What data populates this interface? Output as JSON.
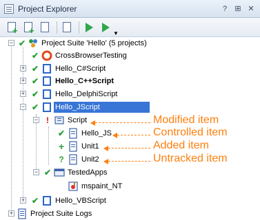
{
  "window": {
    "title": "Project Explorer",
    "buttons": {
      "help": "?",
      "pin": "⊞",
      "close": "✕"
    }
  },
  "toolbar": {
    "icons": [
      "add-project-icon",
      "add-item-icon",
      "add-existing-icon",
      "doc-settings-icon",
      "run-icon",
      "run-dropdown-icon"
    ]
  },
  "tree": {
    "suite_label": "Project Suite 'Hello' (5 projects)",
    "crossbrowser": "CrossBrowserTesting",
    "hello_cs": "Hello_C#Script",
    "hello_cpp": "Hello_C++Script",
    "hello_delphi": "Hello_DelphiScript",
    "hello_js": "Hello_JScript",
    "script": "Script",
    "hello_js_unit": "Hello_JS",
    "unit1": "Unit1",
    "unit2": "Unit2",
    "tested_apps": "TestedApps",
    "mspaint": "mspaint_NT",
    "hello_vb": "Hello_VBScript",
    "suite_logs": "Project Suite Logs"
  },
  "status_symbols": {
    "check": "✔",
    "modified": "!",
    "added": "+",
    "untracked": "?"
  },
  "callouts": {
    "modified": "Modified item",
    "controlled": "Controlled item",
    "added": "Added item",
    "untracked": "Untracked item"
  },
  "colors": {
    "accent": "#ff7f0e",
    "check": "#2e9e3a",
    "modified": "#d01010",
    "selection": "#3875d7"
  }
}
